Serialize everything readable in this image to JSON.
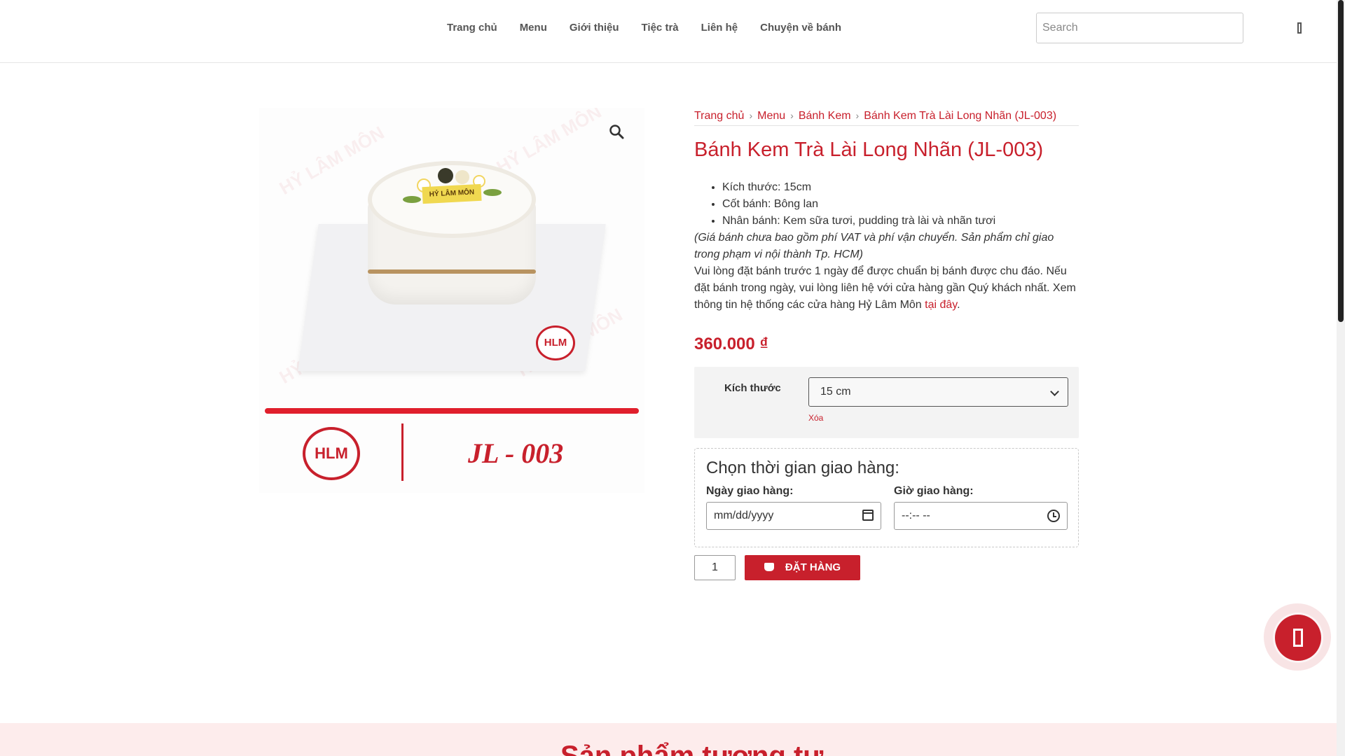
{
  "header": {
    "nav": [
      {
        "label": "Trang chủ"
      },
      {
        "label": "Menu"
      },
      {
        "label": "Giới thiệu"
      },
      {
        "label": "Tiệc trà"
      },
      {
        "label": "Liên hệ"
      },
      {
        "label": "Chuyện về bánh"
      }
    ],
    "search_placeholder": "Search"
  },
  "breadcrumb": [
    "Trang chủ",
    "Menu",
    "Bánh Kem",
    "Bánh Kem Trà Lài Long Nhãn (JL-003)"
  ],
  "product": {
    "title": "Bánh Kem Trà Lài Long Nhãn (JL-003)",
    "specs": [
      "Kích thước: 15cm",
      "Cốt bánh: Bông lan",
      "Nhân bánh: Kem sữa tươi, pudding trà lài và nhãn tươi"
    ],
    "vat_note": "(Giá bánh chưa bao gồm phí VAT và phí vận chuyển. Sản phẩm chỉ giao trong phạm vi nội thành Tp. HCM)",
    "order_note": "Vui lòng đặt bánh trước 1 ngày để được chuẩn bị bánh được chu đáo. Nếu đặt bánh trong ngày, vui lòng liên hệ với cửa hàng gần Quý khách nhất. Xem thông tin hệ thống các cửa hàng Hỷ Lâm Môn",
    "store_link": "tại đây",
    "price": "360.000 ₫",
    "image_label": "HỶ LÂM MÔN",
    "image_logo": "HLM",
    "image_code": "JL - 003"
  },
  "variation": {
    "label": "Kích thước",
    "selected": "15 cm",
    "clear": "Xóa"
  },
  "delivery": {
    "title": "Chọn thời gian giao hàng:",
    "date_label": "Ngày giao hàng:",
    "date_value": "mm/dd/yyyy",
    "time_label": "Giờ giao hàng:",
    "time_value": "--:-- --"
  },
  "cart": {
    "quantity": "1",
    "order_label": "ĐẶT HÀNG"
  },
  "related": {
    "title": "Sản phẩm tương tự"
  },
  "colors": {
    "accent": "#c8202c",
    "related_bg": "#fdecec"
  }
}
